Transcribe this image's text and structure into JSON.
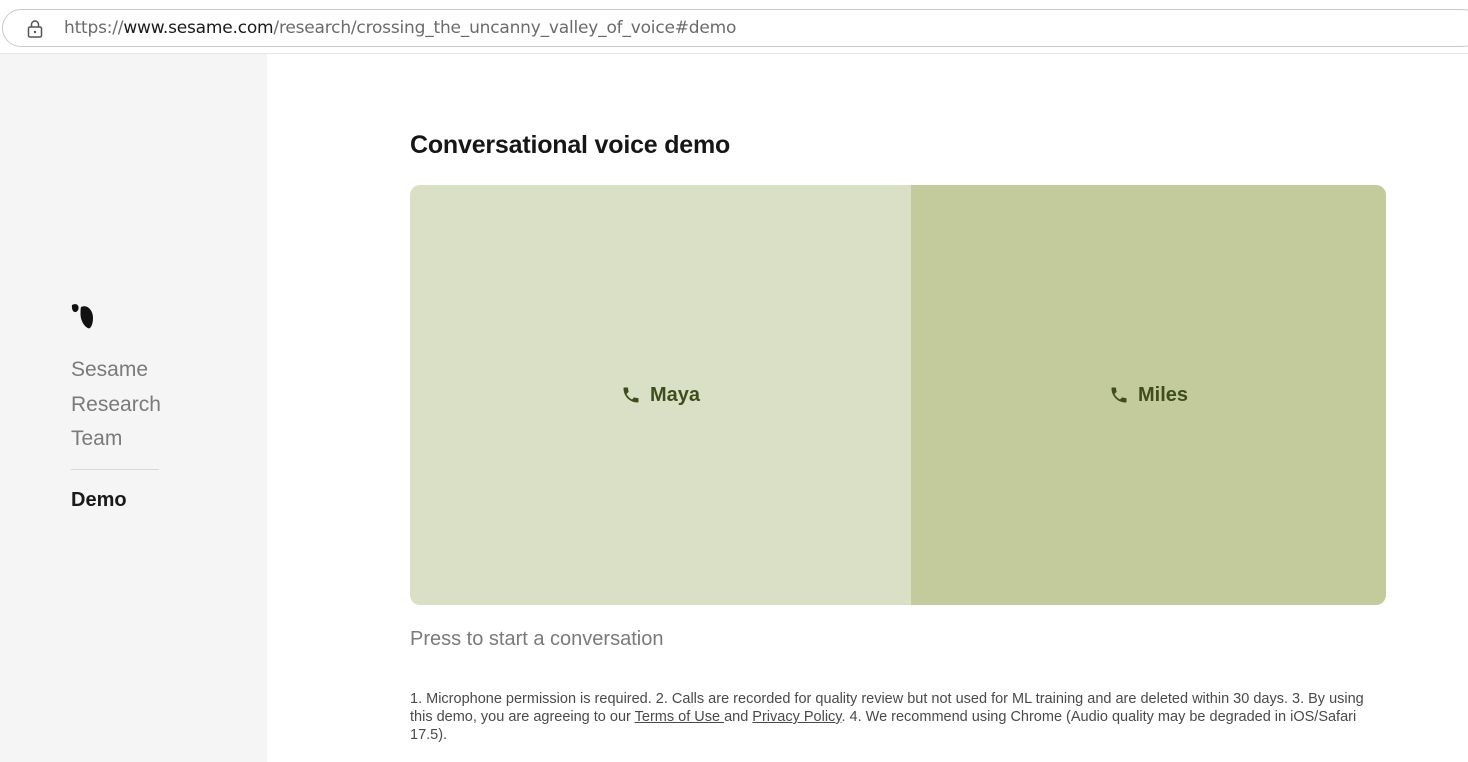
{
  "browser": {
    "url_scheme": "https://",
    "url_host": "www.sesame.com",
    "url_path": "/research/crossing_the_uncanny_valley_of_voice#demo"
  },
  "sidebar": {
    "authors": [
      "Sesame",
      "Research",
      "Team"
    ],
    "nav": {
      "demo": "Demo"
    }
  },
  "main": {
    "title": "Conversational voice demo",
    "voices": [
      {
        "label": "Maya",
        "icon": "phone-icon",
        "color": "#dae0c5"
      },
      {
        "label": "Miles",
        "icon": "phone-icon",
        "color": "#c3cb9c"
      }
    ],
    "hint": "Press to start a conversation",
    "disclaimer": {
      "part1": "1. Microphone permission is required. 2. Calls are recorded for quality review but not used for ML training and are deleted within 30 days. 3. By using this demo, you are agreeing to our ",
      "terms_link": "Terms of Use ",
      "and": "and ",
      "privacy_link": "Privacy Policy",
      "part2": ". 4. We recommend using Chrome (Audio quality may be degraded in iOS/Safari 17.5)."
    }
  },
  "colors": {
    "sidebar_bg": "#f5f5f5",
    "voice_text": "#3f4d1d"
  }
}
